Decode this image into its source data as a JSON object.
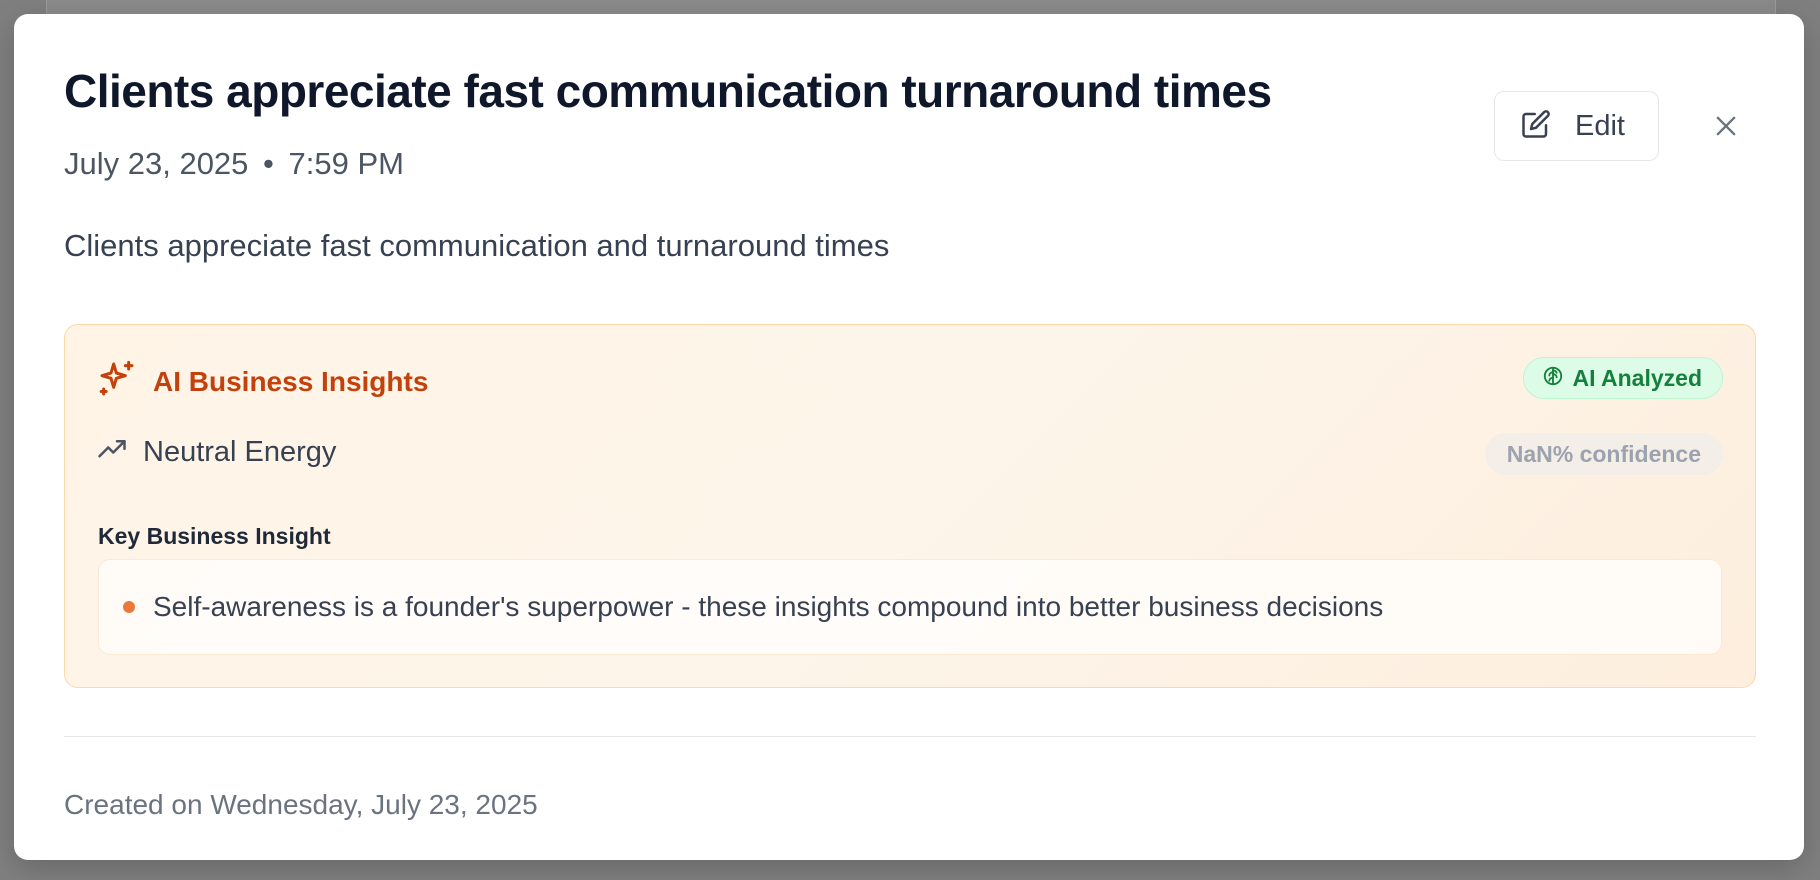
{
  "note": {
    "title": "Clients appreciate fast communication turnaround times",
    "date": "July 23, 2025",
    "separator": "•",
    "time": "7:59 PM",
    "body": "Clients appreciate fast communication and turnaround times",
    "created": "Created on Wednesday, July 23, 2025"
  },
  "actions": {
    "edit_label": "Edit",
    "edit_icon": "pencil-square-icon",
    "close_icon": "close-icon"
  },
  "insights": {
    "title": "AI Business Insights",
    "title_icon": "sparkles-icon",
    "badge_label": "AI Analyzed",
    "badge_icon": "brain-icon",
    "energy_label": "Neutral Energy",
    "energy_icon": "trending-up-icon",
    "confidence_label": "NaN% confidence",
    "key_label": "Key Business Insight",
    "items": [
      "Self-awareness is a founder's superpower - these insights compound into better business decisions"
    ]
  },
  "colors": {
    "accent_orange": "#c2410c",
    "badge_green": "#15803d",
    "badge_green_bg": "#dcfce7",
    "panel_bg": "#fff4e6",
    "panel_border": "#fcd9a6",
    "bullet": "#ea7a3b"
  }
}
